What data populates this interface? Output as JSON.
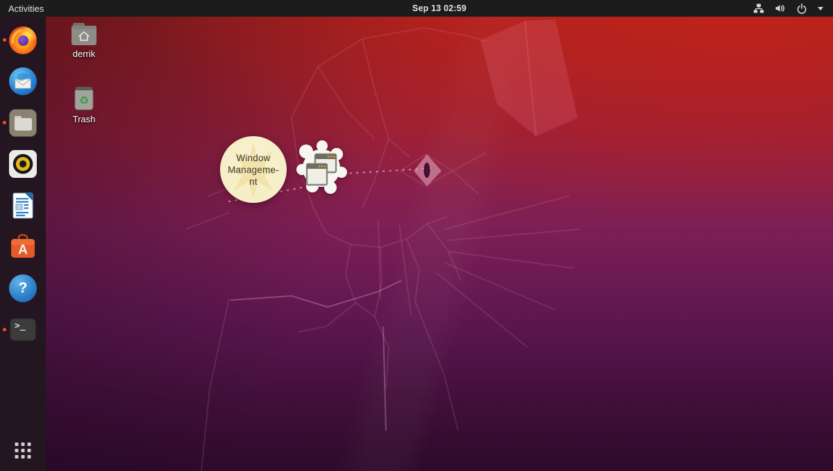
{
  "top_bar": {
    "activities_label": "Activities",
    "clock": "Sep 13 02:59",
    "tray_icons": [
      "wired-network",
      "volume-high",
      "power",
      "dropdown-arrow"
    ]
  },
  "dock": {
    "items": [
      {
        "id": "firefox",
        "running": true
      },
      {
        "id": "thunderbird",
        "running": false
      },
      {
        "id": "files",
        "running": true
      },
      {
        "id": "rhythmbox",
        "running": false
      },
      {
        "id": "libreoffice-writer",
        "running": false
      },
      {
        "id": "ubuntu-software",
        "running": false
      },
      {
        "id": "help",
        "running": false
      },
      {
        "id": "terminal",
        "running": true
      }
    ],
    "terminal_glyph": ">_",
    "help_glyph": "?",
    "software_glyph": "A"
  },
  "desktop": {
    "icons": [
      {
        "label": "derrik",
        "type": "home-folder"
      },
      {
        "label": "Trash",
        "type": "trash"
      }
    ],
    "trash_glyph": "♻",
    "tooltip_balloon": {
      "lines": [
        "Window",
        "Manageme-",
        "nt"
      ]
    }
  },
  "colors": {
    "accent_orange": "#e95420",
    "topbar_bg": "#1c1c1c",
    "dock_bg": "#231621",
    "balloon_bg": "#f6edc4",
    "balloon_text": "#3f3b35",
    "wallpaper_top": "#a2211f",
    "wallpaper_bottom": "#2d0a2a"
  }
}
